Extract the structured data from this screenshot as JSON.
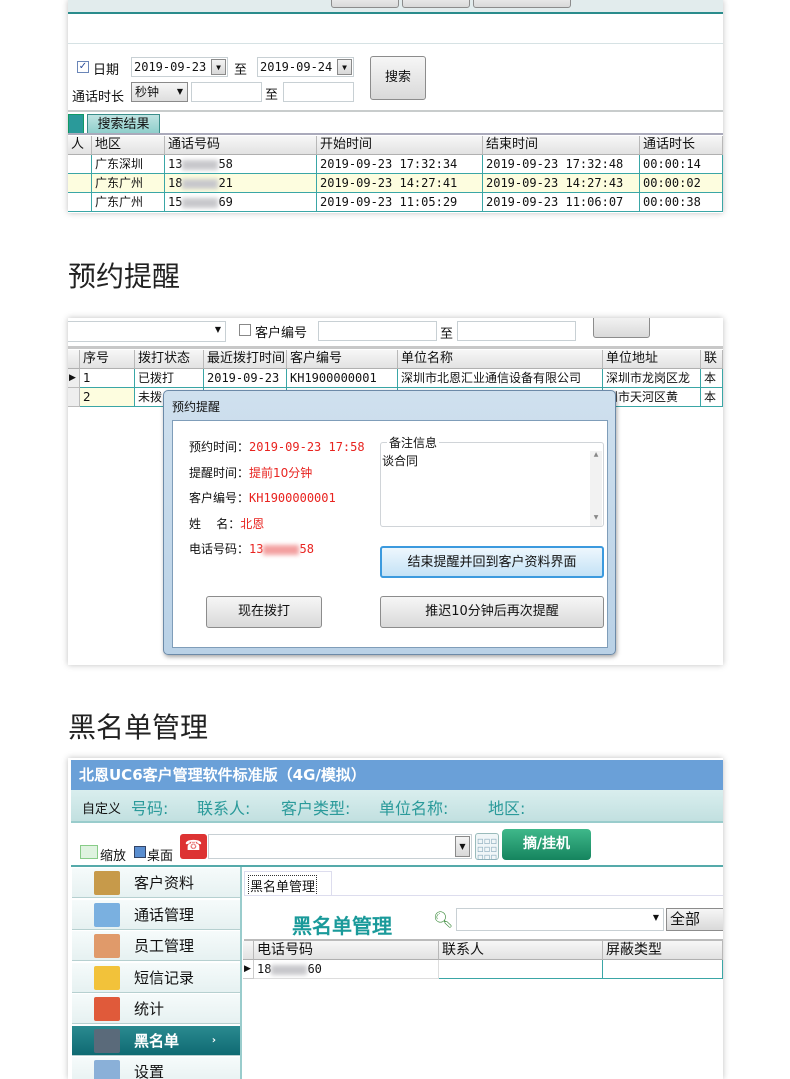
{
  "call_log": {
    "date_label": "日期",
    "date_from": "2019-09-23",
    "to": "至",
    "date_to": "2019-09-24",
    "search_button": "搜索",
    "duration_label": "通话时长",
    "duration_unit": "秒钟",
    "to2": "至",
    "tab": "搜索结果",
    "columns": [
      "人",
      "地区",
      "通话号码",
      "开始时间",
      "结束时间",
      "通话时长"
    ],
    "rows": [
      {
        "region": "广东深圳",
        "phone_prefix": "13",
        "phone_suffix": "58",
        "start": "2019-09-23 17:32:34",
        "end": "2019-09-23 17:32:48",
        "duration": "00:00:14"
      },
      {
        "region": "广东广州",
        "phone_prefix": "18",
        "phone_suffix": "21",
        "start": "2019-09-23 14:27:41",
        "end": "2019-09-23 14:27:43",
        "duration": "00:00:02"
      },
      {
        "region": "广东广州",
        "phone_prefix": "15",
        "phone_suffix": "69",
        "start": "2019-09-23 11:05:29",
        "end": "2019-09-23 11:06:07",
        "duration": "00:00:38"
      }
    ]
  },
  "section2_title": "预约提醒",
  "reminder": {
    "customer_no_label": "客户编号",
    "to": "至",
    "columns": [
      "序号",
      "拨打状态",
      "最近拨打时间",
      "客户编号",
      "单位名称",
      "单位地址",
      "联"
    ],
    "rows": [
      {
        "no": "1",
        "status": "已拨打",
        "last": "2019-09-23",
        "cust": "KH1900000001",
        "company": "深圳市北恩汇业通信设备有限公司",
        "addr": "深圳市龙岗区龙",
        "extra": "本"
      },
      {
        "no": "2",
        "status": "未拨",
        "last": "",
        "cust": "",
        "company": "",
        "addr": "州市天河区黄",
        "extra": "本"
      }
    ],
    "dialog": {
      "title": "预约提醒",
      "appt_label": "预约时间：",
      "appt_value": "2019-09-23  17:58",
      "remind_label": "提醒时间：",
      "remind_value": "提前10分钟",
      "cust_label": "客户编号：",
      "cust_value": "KH1900000001",
      "name_label": "姓    名：",
      "name_value": "北恩",
      "phone_label": "电话号码：",
      "phone_prefix": "13",
      "phone_suffix": "58",
      "remarks_label": "备注信息",
      "remarks_value": "谈合同",
      "end_button": "结束提醒并回到客户资料界面",
      "dial_button": "现在拨打",
      "snooze_button": "推迟10分钟后再次提醒"
    }
  },
  "section3_title": "黑名单管理",
  "app": {
    "title": "北恩UC6客户管理软件标准版（4G/模拟）",
    "fields": [
      "自定义",
      "号码:",
      "联系人:",
      "客户类型:",
      "单位名称:",
      "地区:"
    ],
    "zoom_label": "缩放",
    "desktop_label": "桌面",
    "dial_button": "摘/挂机",
    "sidebar": [
      "客户资料",
      "通话管理",
      "员工管理",
      "短信记录",
      "统计",
      "黑名单",
      "设置"
    ],
    "tab": "黑名单管理",
    "page_heading": "黑名单管理",
    "filter": "全部",
    "columns": [
      "电话号码",
      "联系人",
      "屏蔽类型"
    ],
    "rows": [
      {
        "phone_prefix": "18",
        "phone_suffix": "60"
      }
    ],
    "accent": "#1a9a9a"
  }
}
